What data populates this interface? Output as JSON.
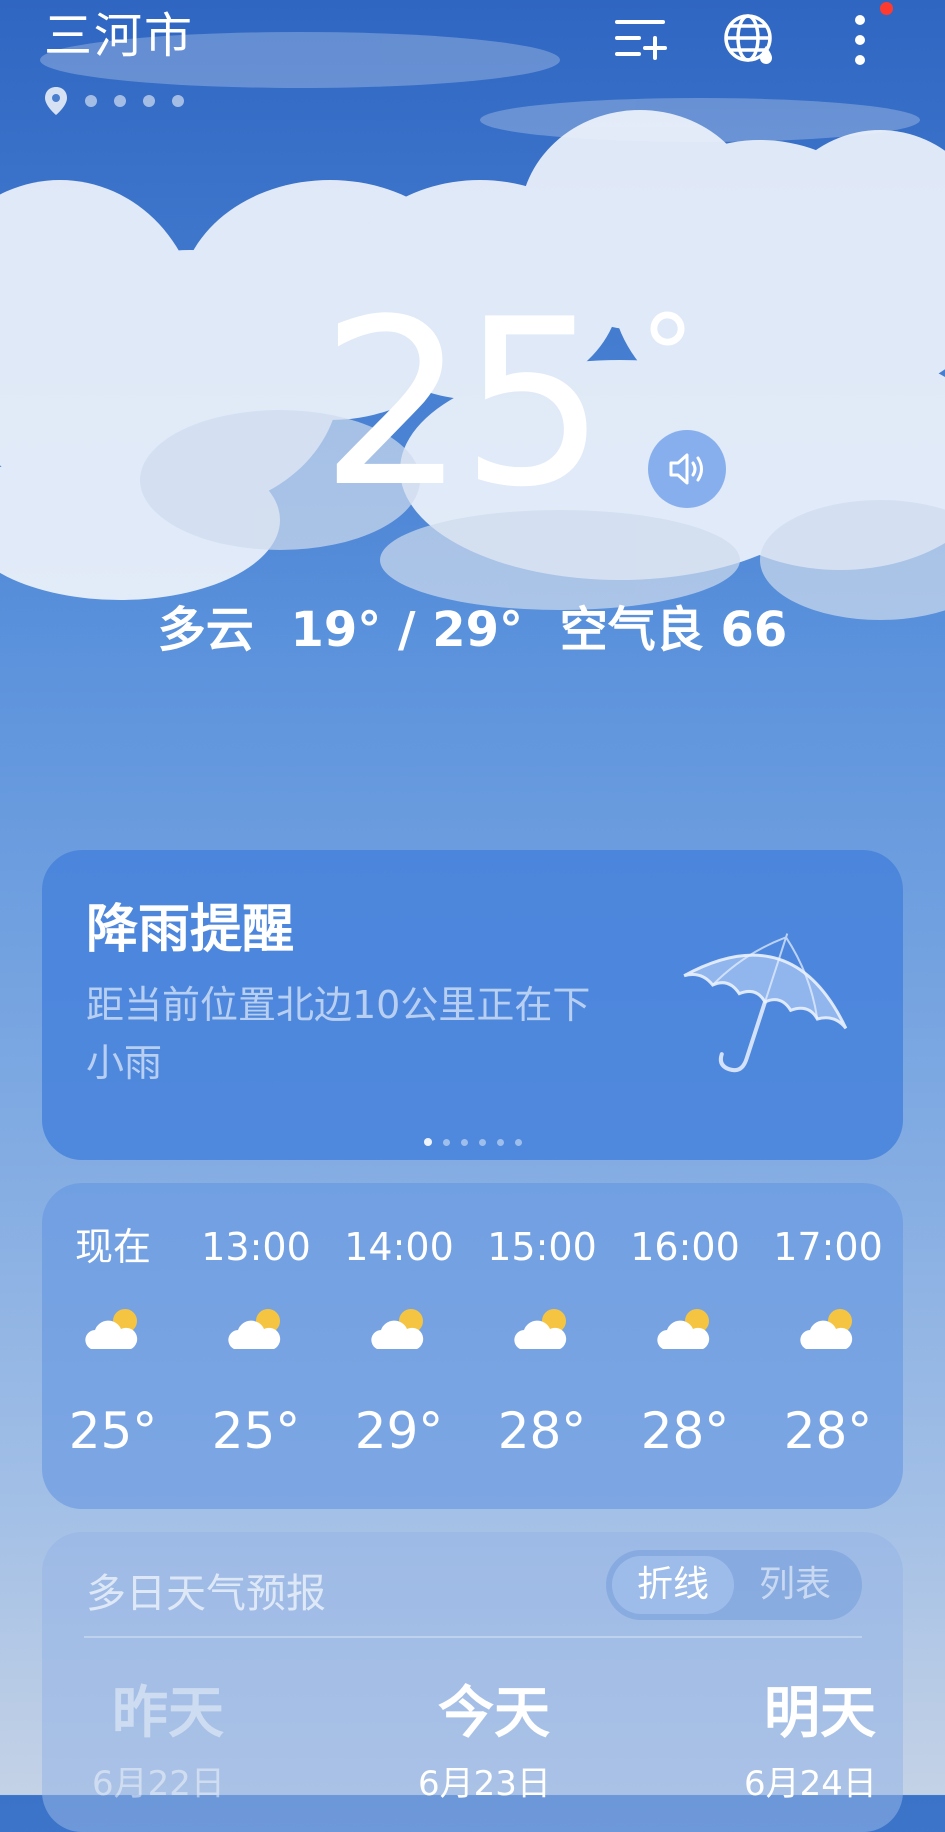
{
  "header": {
    "city": "三河市",
    "location_pages": 4,
    "icons": [
      "add-city-icon",
      "globe-icon",
      "more-icon"
    ]
  },
  "current": {
    "temperature": "25",
    "degree_symbol": "°",
    "condition": "多云",
    "range": "19° / 29°",
    "aqi": "空气良 66"
  },
  "alert": {
    "title": "降雨提醒",
    "message": "距当前位置北边10公里正在下小雨",
    "pages": 6,
    "active_page": 0
  },
  "hourly": [
    {
      "time": "现在",
      "icon": "partly-cloudy-icon",
      "temp": "25°"
    },
    {
      "time": "13:00",
      "icon": "partly-cloudy-icon",
      "temp": "25°"
    },
    {
      "time": "14:00",
      "icon": "partly-cloudy-icon",
      "temp": "29°"
    },
    {
      "time": "15:00",
      "icon": "partly-cloudy-icon",
      "temp": "28°"
    },
    {
      "time": "16:00",
      "icon": "partly-cloudy-icon",
      "temp": "28°"
    },
    {
      "time": "17:00",
      "icon": "partly-cloudy-icon",
      "temp": "28°"
    }
  ],
  "forecast": {
    "title": "多日天气预报",
    "toggle": {
      "line": "折线",
      "list": "列表",
      "selected": "折线"
    },
    "days": [
      {
        "day": "昨天",
        "date": "6月22日"
      },
      {
        "day": "今天",
        "date": "6月23日"
      },
      {
        "day": "明天",
        "date": "6月24日"
      }
    ]
  },
  "colors": {
    "accent_red": "#ff3b30",
    "sun": "#f5c542"
  }
}
